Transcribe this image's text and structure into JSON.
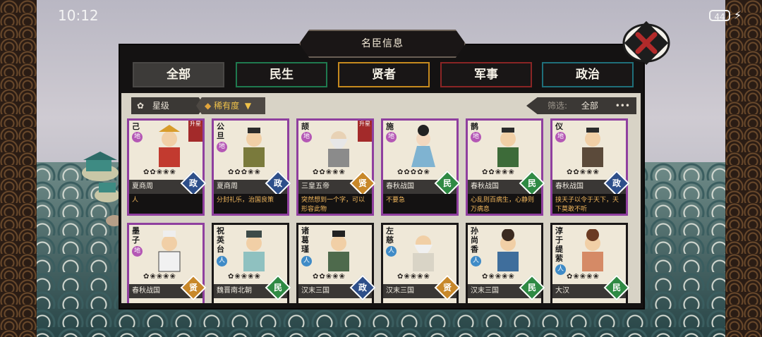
{
  "status_bar": {
    "time": "10:12",
    "battery": "44"
  },
  "window": {
    "title": "名臣信息"
  },
  "tabs": [
    {
      "label": "全部",
      "color": "#4a4846"
    },
    {
      "label": "民生",
      "color": "#1f7a4f"
    },
    {
      "label": "贤者",
      "color": "#c68a1e"
    },
    {
      "label": "军事",
      "color": "#8a2525"
    },
    {
      "label": "政治",
      "color": "#1f6f7a"
    }
  ],
  "filters": {
    "star_label": "星级",
    "rarity_label": "稀有度",
    "filter_label": "筛选:",
    "filter_value": "全部",
    "more": "•••"
  },
  "cards_top": [
    {
      "name": "己",
      "badge": "地",
      "era": "夏商周",
      "type": "政",
      "desc": "人",
      "tag": "升星",
      "stars": "✿✿❀❀❀"
    },
    {
      "name": "公旦",
      "badge": "地",
      "era": "夏商周",
      "type": "政",
      "desc": "分封礼乐，治国良策",
      "tag": "",
      "stars": "✿✿✿❀❀"
    },
    {
      "name": "颉",
      "badge": "地",
      "era": "三皇五帝",
      "type": "贤",
      "desc": "突然想到一个字，可以形容此物",
      "tag": "升星",
      "stars": "✿✿❀❀❀"
    },
    {
      "name": "施",
      "badge": "地",
      "era": "春秋战国",
      "type": "民",
      "desc": "不要急",
      "tag": "",
      "stars": "✿✿✿✿❀"
    },
    {
      "name": "鹊",
      "badge": "地",
      "era": "春秋战国",
      "type": "民",
      "desc": "心乱则百病生，心静则万病息",
      "tag": "",
      "stars": "✿✿❀❀❀"
    },
    {
      "name": "仪",
      "badge": "地",
      "era": "春秋战国",
      "type": "政",
      "desc": "挟天子以令于天下，天下莫敢不听",
      "tag": "",
      "stars": "✿✿❀❀❀"
    }
  ],
  "cards_bottom": [
    {
      "name": "墨子",
      "badge": "地",
      "era": "春秋战国",
      "type": "贤",
      "stars": "✿❀❀❀❀"
    },
    {
      "name": "祝英台",
      "badge": "人",
      "era": "魏晋南北朝",
      "type": "民",
      "stars": "✿❀❀❀❀"
    },
    {
      "name": "诸葛瑾",
      "badge": "人",
      "era": "汉末三国",
      "type": "政",
      "stars": "✿✿❀❀❀"
    },
    {
      "name": "左慈",
      "badge": "人",
      "era": "汉末三国",
      "type": "贤",
      "stars": "✿❀❀❀❀"
    },
    {
      "name": "孙尚香",
      "badge": "人",
      "era": "汉末三国",
      "type": "民",
      "stars": "✿❀❀❀❀"
    },
    {
      "name": "淳于缇萦",
      "badge": "人",
      "era": "大汉",
      "type": "民",
      "stars": "✿❀❀❀❀"
    }
  ],
  "type_colors": {
    "政": "#2e4f8a",
    "民": "#2f8a44",
    "贤": "#c8882a"
  }
}
